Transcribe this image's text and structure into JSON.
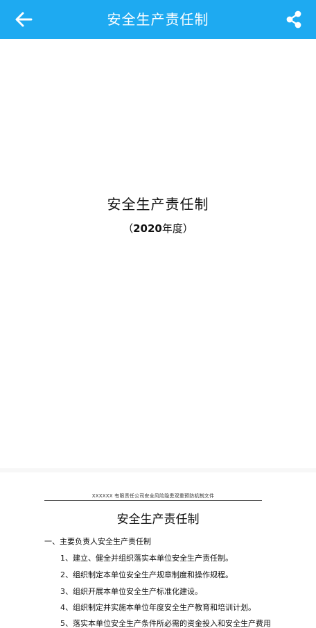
{
  "header": {
    "title": "安全生产责任制",
    "back_icon": "arrow-left-icon",
    "share_icon": "share-icon",
    "bar_color": "#1eaaf1"
  },
  "cover": {
    "title": "安全生产责任制",
    "year_open": "（",
    "year_num": "2020",
    "year_suffix": "年度",
    "year_close": "）"
  },
  "page2": {
    "doc_header": "XXXXXX  有限责任公司安全风险隐患双重预防机制文件",
    "title": "安全生产责任制",
    "section": "一、主要负责人安全生产责任制",
    "items": [
      "1、建立、健全并组织落实本单位安全生产责任制。",
      "2、组织制定本单位安全生产规章制度和操作规程。",
      "3、组织开展本单位安全生产标准化建设。",
      "4、组织制定并实施本单位年度安全生产教育和培训计划。",
      "5、落实本单位安全生产条件所必需的资金投入和安全生产费用"
    ]
  }
}
